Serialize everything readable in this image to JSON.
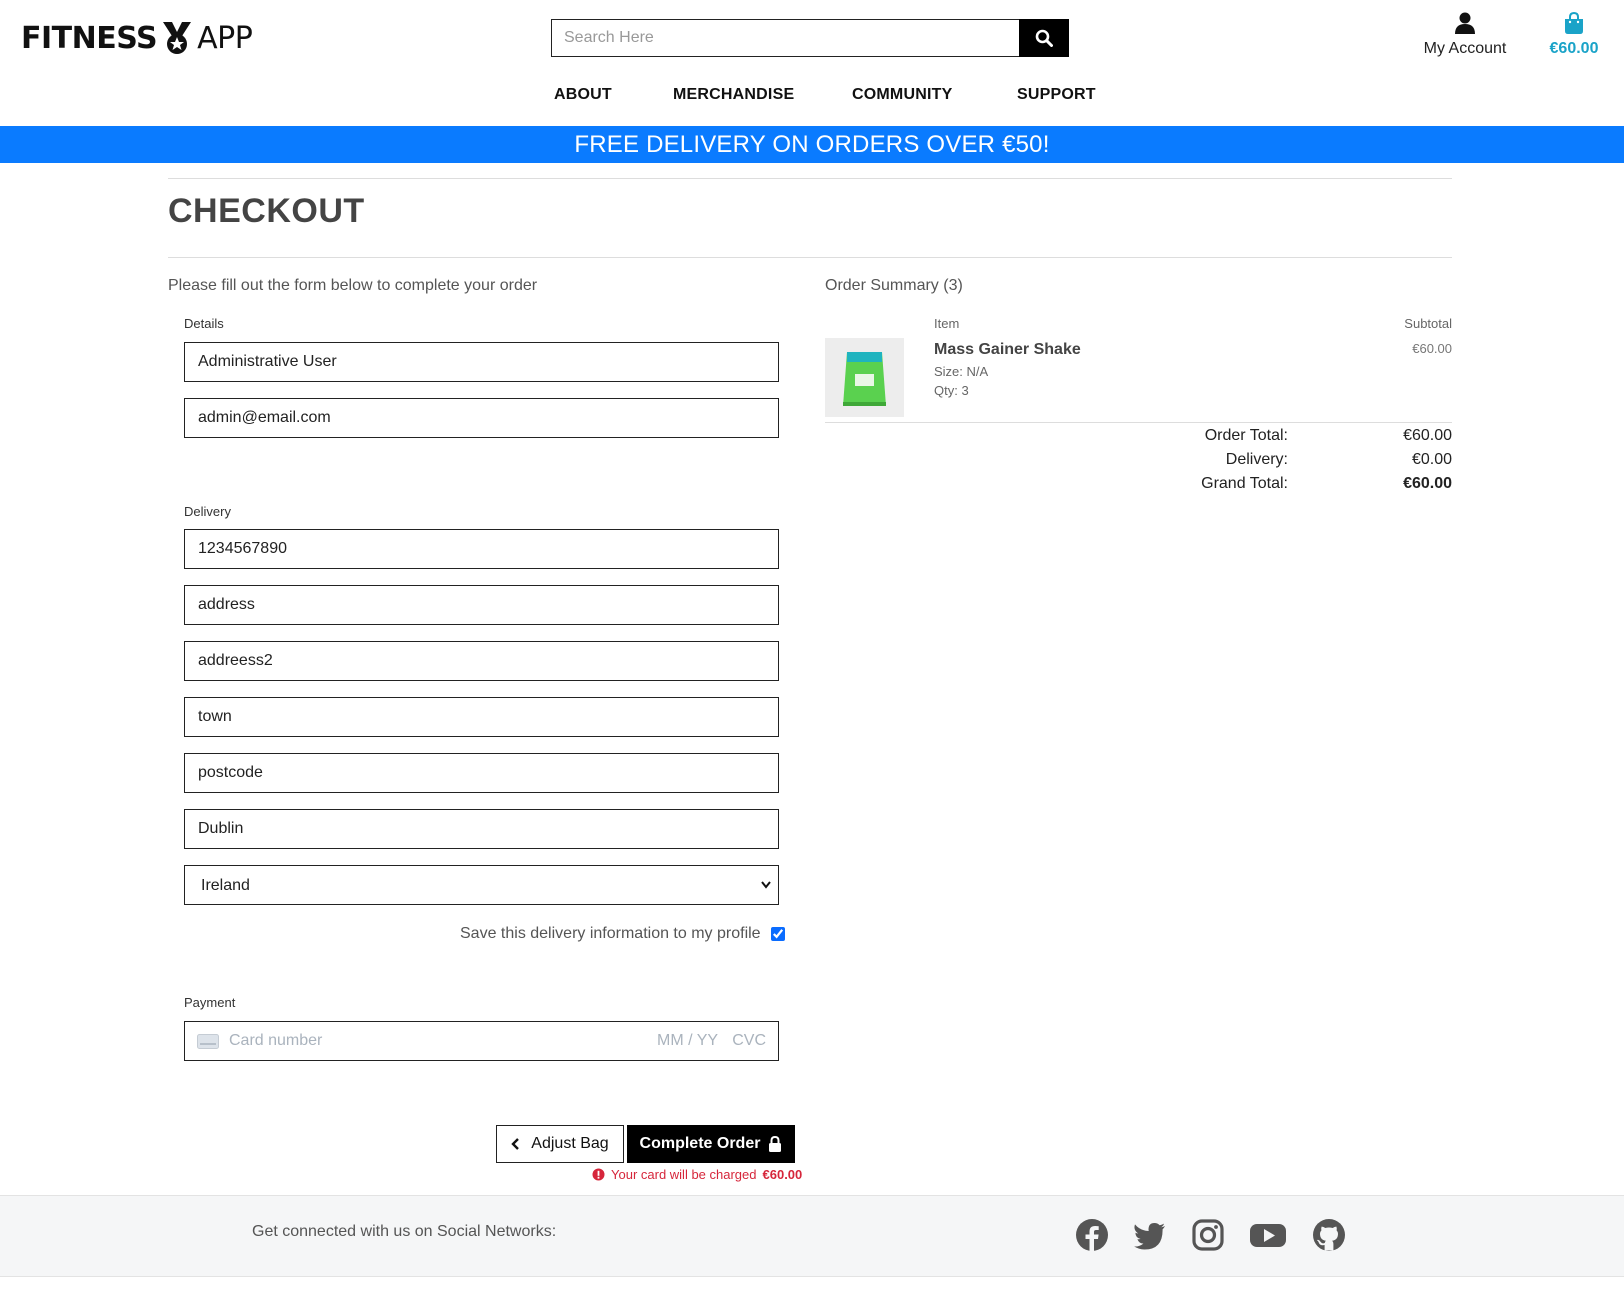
{
  "header": {
    "logo_left": "FITNESS",
    "logo_right": "APP",
    "search_placeholder": "Search Here",
    "account_label": "My Account",
    "bag_total": "€60.00"
  },
  "nav": [
    "ABOUT",
    "MERCHANDISE",
    "COMMUNITY",
    "SUPPORT"
  ],
  "banner": "FREE DELIVERY ON ORDERS OVER €50!",
  "page_title": "CHECKOUT",
  "form": {
    "intro": "Please fill out the form below to complete your order",
    "details_label": "Details",
    "full_name": "Administrative User",
    "email": "admin@email.com",
    "delivery_label": "Delivery",
    "phone": "1234567890",
    "address1": "address",
    "address2": "addreess2",
    "town": "town",
    "postcode": "postcode",
    "county": "Dublin",
    "country": "Ireland",
    "save_info_label": "Save this delivery information to my profile",
    "save_info_checked": true,
    "payment_label": "Payment",
    "card_placeholder": "Card number",
    "card_expiry_placeholder": "MM / YY",
    "card_cvc_placeholder": "CVC",
    "adjust_bag_label": "Adjust Bag",
    "complete_order_label": "Complete Order",
    "charge_text": "Your card will be charged",
    "charge_amount": "€60.00"
  },
  "summary": {
    "title": "Order Summary (3)",
    "col_item": "Item",
    "col_subtotal": "Subtotal",
    "items": [
      {
        "name": "Mass Gainer Shake",
        "size": "Size: N/A",
        "qty": "Qty: 3",
        "subtotal": "€60.00"
      }
    ],
    "order_total_label": "Order Total:",
    "order_total": "€60.00",
    "delivery_label": "Delivery:",
    "delivery": "€0.00",
    "grand_total_label": "Grand Total:",
    "grand_total": "€60.00"
  },
  "footer": {
    "text": "Get connected with us on Social Networks:",
    "icons": [
      "facebook-icon",
      "twitter-icon",
      "instagram-icon",
      "youtube-icon",
      "github-icon"
    ]
  },
  "colors": {
    "banner": "#0a7bff",
    "bag_accent": "#1aa3c8",
    "charge_warning": "#d6263b",
    "primary_button": "#000000"
  }
}
